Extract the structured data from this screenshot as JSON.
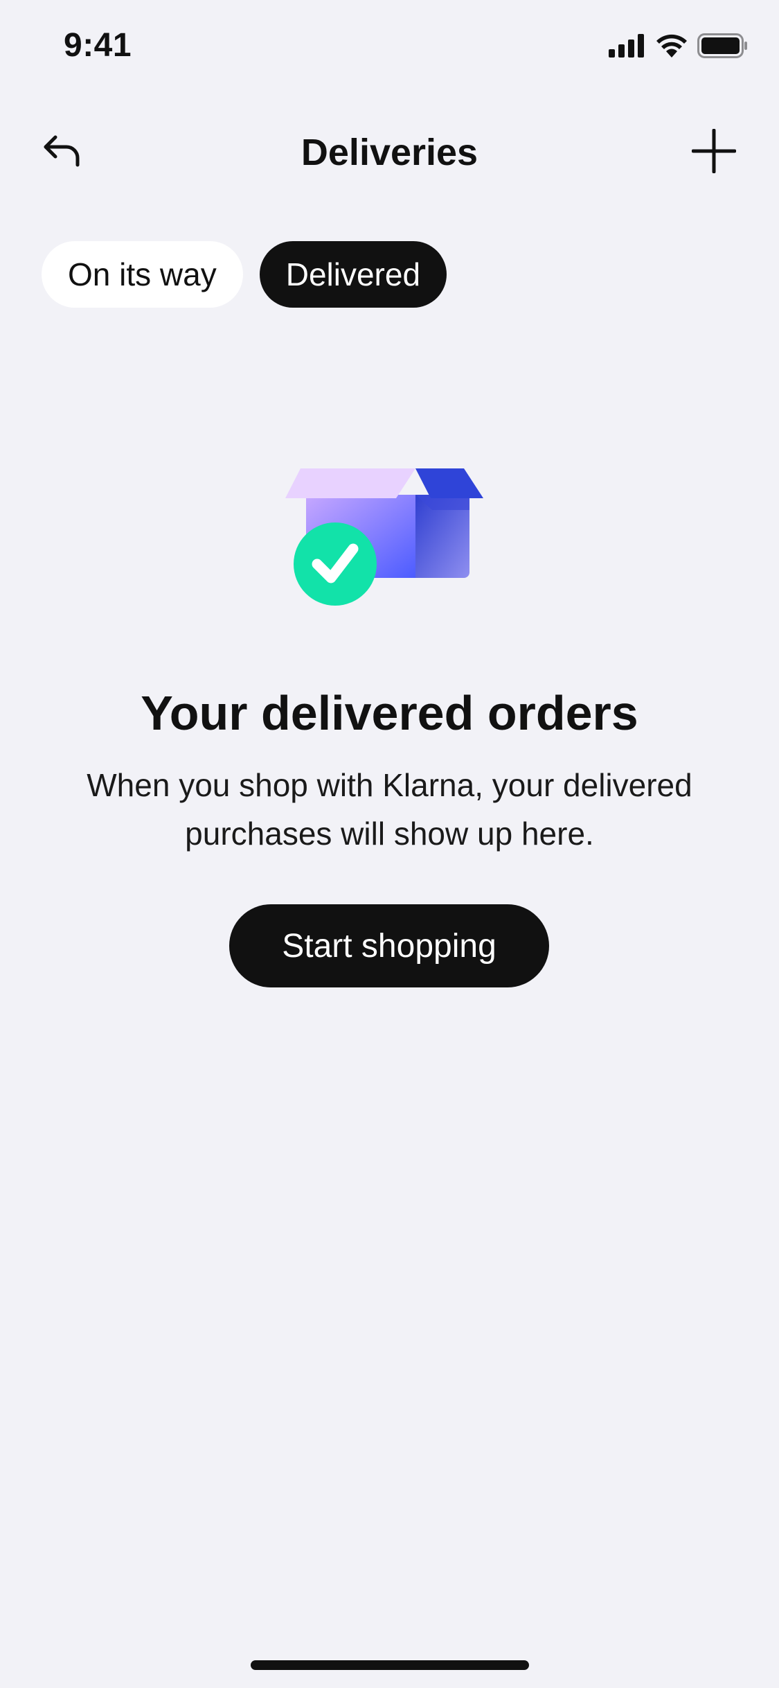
{
  "status_bar": {
    "time": "9:41",
    "icons": [
      "cellular-signal-icon",
      "wifi-icon",
      "battery-icon"
    ]
  },
  "header": {
    "back_icon": "back-arrow-icon",
    "title": "Deliveries",
    "add_icon": "plus-icon"
  },
  "tabs": [
    {
      "label": "On its way",
      "selected": false
    },
    {
      "label": "Delivered",
      "selected": true
    }
  ],
  "empty_state": {
    "illustration_icon": "delivered-box-icon",
    "title": "Your delivered orders",
    "body": "When you shop with Klarna, your delivered purchases will show up here.",
    "cta_label": "Start shopping"
  },
  "colors": {
    "background": "#f2f2f7",
    "primary": "#111111",
    "check_green": "#12e2a9",
    "box_blue": "#5a5cf5",
    "box_lavender": "#e6d0ff"
  }
}
